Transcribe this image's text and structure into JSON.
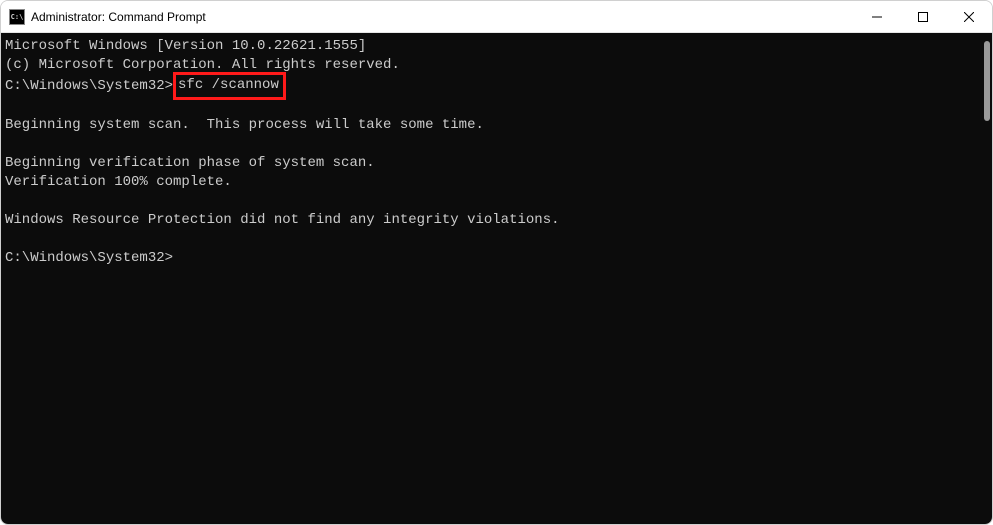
{
  "titlebar": {
    "icon_text": "C:\\",
    "title": "Administrator: Command Prompt"
  },
  "console": {
    "line1": "Microsoft Windows [Version 10.0.22621.1555]",
    "line2": "(c) Microsoft Corporation. All rights reserved.",
    "blank": "",
    "prompt1_prefix": "C:\\Windows\\System32>",
    "prompt1_command": "sfc /scannow",
    "line4": "Beginning system scan.  This process will take some time.",
    "line5": "Beginning verification phase of system scan.",
    "line6": "Verification 100% complete.",
    "line7": "Windows Resource Protection did not find any integrity violations.",
    "prompt2": "C:\\Windows\\System32>"
  }
}
